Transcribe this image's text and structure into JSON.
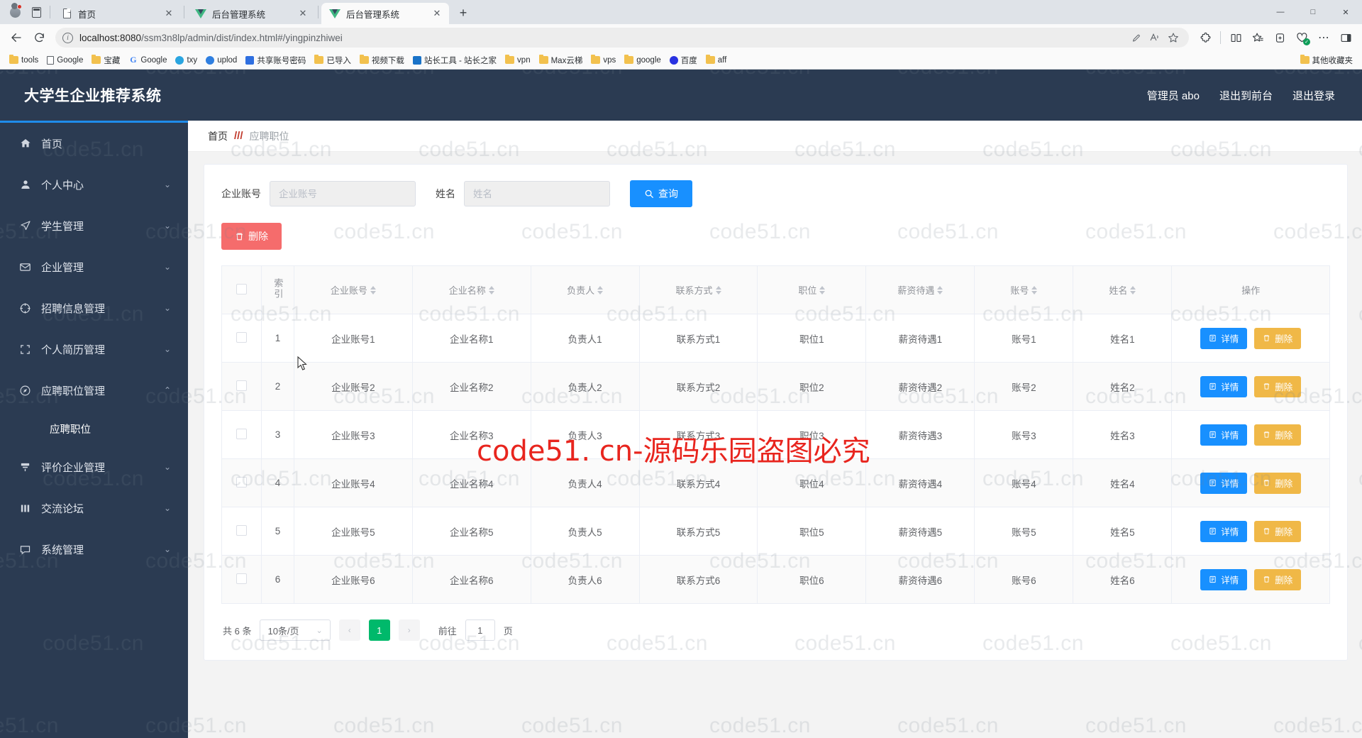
{
  "browser": {
    "tabs": [
      {
        "title": "首页",
        "favicon": "doc-icon",
        "active": false,
        "closable": true
      },
      {
        "title": "后台管理系统",
        "favicon": "vue-icon",
        "active": false,
        "closable": true
      },
      {
        "title": "后台管理系统",
        "favicon": "vue-icon",
        "active": true,
        "closable": true
      }
    ],
    "new_tab_label": "+",
    "window_controls": {
      "minimize": "—",
      "maximize": "□",
      "close": "✕"
    },
    "nav": {
      "back": "←",
      "reload": "⟳"
    },
    "url": {
      "host": "localhost:8080",
      "path": "/ssm3n8lp/admin/dist/index.html#/yingpinzhiwei"
    },
    "omnibox_icons": [
      "info-icon",
      "edit-pen-icon",
      "read-aloud-icon",
      "favorite-star-icon"
    ],
    "toolbar_icons": [
      "extensions-icon",
      "split-screen-icon",
      "collections-icon",
      "add-to-collection-icon",
      "browser-essentials-icon",
      "more-options-icon",
      "sidebar-toggle-icon"
    ],
    "bookmarks": [
      {
        "label": "tools",
        "icon": "folder-icon"
      },
      {
        "label": "Google",
        "icon": "doc-icon"
      },
      {
        "label": "宝藏",
        "icon": "folder-icon"
      },
      {
        "label": "Google",
        "icon": "google-g-icon"
      },
      {
        "label": "txy",
        "icon": "cloud-icon"
      },
      {
        "label": "uplod",
        "icon": "person-icon"
      },
      {
        "label": "共享账号密码",
        "icon": "share-icon"
      },
      {
        "label": "已导入",
        "icon": "folder-icon"
      },
      {
        "label": "视频下载",
        "icon": "folder-icon"
      },
      {
        "label": "站长工具 - 站长之家",
        "icon": "chinaz-icon"
      },
      {
        "label": "vpn",
        "icon": "folder-icon"
      },
      {
        "label": "Max云梯",
        "icon": "folder-icon"
      },
      {
        "label": "vps",
        "icon": "folder-icon"
      },
      {
        "label": "google",
        "icon": "folder-icon"
      },
      {
        "label": "百度",
        "icon": "baidu-icon"
      },
      {
        "label": "aff",
        "icon": "folder-icon"
      }
    ],
    "bookmarks_overflow": "其他收藏夹"
  },
  "app": {
    "title": "大学生企业推荐系统",
    "header_links": [
      {
        "label": "管理员 abo"
      },
      {
        "label": "退出到前台"
      },
      {
        "label": "退出登录"
      }
    ],
    "sidebar": [
      {
        "label": "首页",
        "icon": "home-icon",
        "expandable": false,
        "active": false
      },
      {
        "label": "个人中心",
        "icon": "user-icon",
        "expandable": true,
        "active": false
      },
      {
        "label": "学生管理",
        "icon": "send-icon",
        "expandable": true,
        "active": false
      },
      {
        "label": "企业管理",
        "icon": "mail-icon",
        "expandable": true,
        "active": false
      },
      {
        "label": "招聘信息管理",
        "icon": "target-icon",
        "expandable": true,
        "active": false
      },
      {
        "label": "个人简历管理",
        "icon": "crop-icon",
        "expandable": true,
        "active": false
      },
      {
        "label": "应聘职位管理",
        "icon": "compass-icon",
        "expandable": true,
        "active": true
      },
      {
        "label": "评价企业管理",
        "icon": "filter-icon",
        "expandable": true,
        "active": false
      },
      {
        "label": "交流论坛",
        "icon": "chart-icon",
        "expandable": false,
        "active": false
      },
      {
        "label": "系统管理",
        "icon": "comment-icon",
        "expandable": true,
        "active": false
      }
    ],
    "submenu": {
      "parent_index": 6,
      "label": "应聘职位"
    },
    "breadcrumb": {
      "home": "首页",
      "separator": "///",
      "current": "应聘职位"
    },
    "search": {
      "field1": {
        "label": "企业账号",
        "placeholder": "企业账号",
        "value": ""
      },
      "field2": {
        "label": "姓名",
        "placeholder": "姓名",
        "value": ""
      },
      "button": {
        "label": "查询",
        "icon": "search-icon"
      }
    },
    "toolbar": {
      "delete": {
        "label": "删除",
        "icon": "trash-icon"
      }
    },
    "table": {
      "columns": [
        {
          "key": "select",
          "label": "",
          "sortable": false
        },
        {
          "key": "index",
          "label": "索引",
          "sortable": false
        },
        {
          "key": "qiyezhanghao",
          "label": "企业账号",
          "sortable": true
        },
        {
          "key": "qiyemingcheng",
          "label": "企业名称",
          "sortable": true
        },
        {
          "key": "fuzeren",
          "label": "负责人",
          "sortable": true
        },
        {
          "key": "lianxifangshi",
          "label": "联系方式",
          "sortable": true
        },
        {
          "key": "zhiwei",
          "label": "职位",
          "sortable": true
        },
        {
          "key": "xinzidaiyu",
          "label": "薪资待遇",
          "sortable": true
        },
        {
          "key": "zhanghao",
          "label": "账号",
          "sortable": true
        },
        {
          "key": "xingming",
          "label": "姓名",
          "sortable": true
        },
        {
          "key": "caozuo",
          "label": "操作",
          "sortable": false
        }
      ],
      "rows": [
        {
          "index": "1",
          "qiyezhanghao": "企业账号1",
          "qiyemingcheng": "企业名称1",
          "fuzeren": "负责人1",
          "lianxifangshi": "联系方式1",
          "zhiwei": "职位1",
          "xinzidaiyu": "薪资待遇1",
          "zhanghao": "账号1",
          "xingming": "姓名1"
        },
        {
          "index": "2",
          "qiyezhanghao": "企业账号2",
          "qiyemingcheng": "企业名称2",
          "fuzeren": "负责人2",
          "lianxifangshi": "联系方式2",
          "zhiwei": "职位2",
          "xinzidaiyu": "薪资待遇2",
          "zhanghao": "账号2",
          "xingming": "姓名2"
        },
        {
          "index": "3",
          "qiyezhanghao": "企业账号3",
          "qiyemingcheng": "企业名称3",
          "fuzeren": "负责人3",
          "lianxifangshi": "联系方式3",
          "zhiwei": "职位3",
          "xinzidaiyu": "薪资待遇3",
          "zhanghao": "账号3",
          "xingming": "姓名3"
        },
        {
          "index": "4",
          "qiyezhanghao": "企业账号4",
          "qiyemingcheng": "企业名称4",
          "fuzeren": "负责人4",
          "lianxifangshi": "联系方式4",
          "zhiwei": "职位4",
          "xinzidaiyu": "薪资待遇4",
          "zhanghao": "账号4",
          "xingming": "姓名4"
        },
        {
          "index": "5",
          "qiyezhanghao": "企业账号5",
          "qiyemingcheng": "企业名称5",
          "fuzeren": "负责人5",
          "lianxifangshi": "联系方式5",
          "zhiwei": "职位5",
          "xinzidaiyu": "薪资待遇5",
          "zhanghao": "账号5",
          "xingming": "姓名5"
        },
        {
          "index": "6",
          "qiyezhanghao": "企业账号6",
          "qiyemingcheng": "企业名称6",
          "fuzeren": "负责人6",
          "lianxifangshi": "联系方式6",
          "zhiwei": "职位6",
          "xinzidaiyu": "薪资待遇6",
          "zhanghao": "账号6",
          "xingming": "姓名6"
        }
      ],
      "row_actions": {
        "detail": {
          "label": "详情",
          "icon": "document-icon"
        },
        "delete": {
          "label": "删除",
          "icon": "trash-icon"
        }
      }
    },
    "pagination": {
      "total_text": "共 6 条",
      "page_size": "10条/页",
      "prev": "‹",
      "next": "›",
      "current_page": "1",
      "jump_prefix": "前往",
      "jump_value": "1",
      "jump_suffix": "页"
    },
    "colors": {
      "header_bg": "#2b3b52",
      "accent_blue": "#1890ff",
      "danger_red": "#f56c6c",
      "warn_yellow": "#f0b847",
      "page_active_green": "#00b96b",
      "top_border_blue": "#1f8ceb"
    }
  },
  "watermarks": {
    "tile_text": "code51.cn",
    "center_text": "code51. cn-源码乐园盗图必究",
    "center_color": "#e8251e"
  }
}
